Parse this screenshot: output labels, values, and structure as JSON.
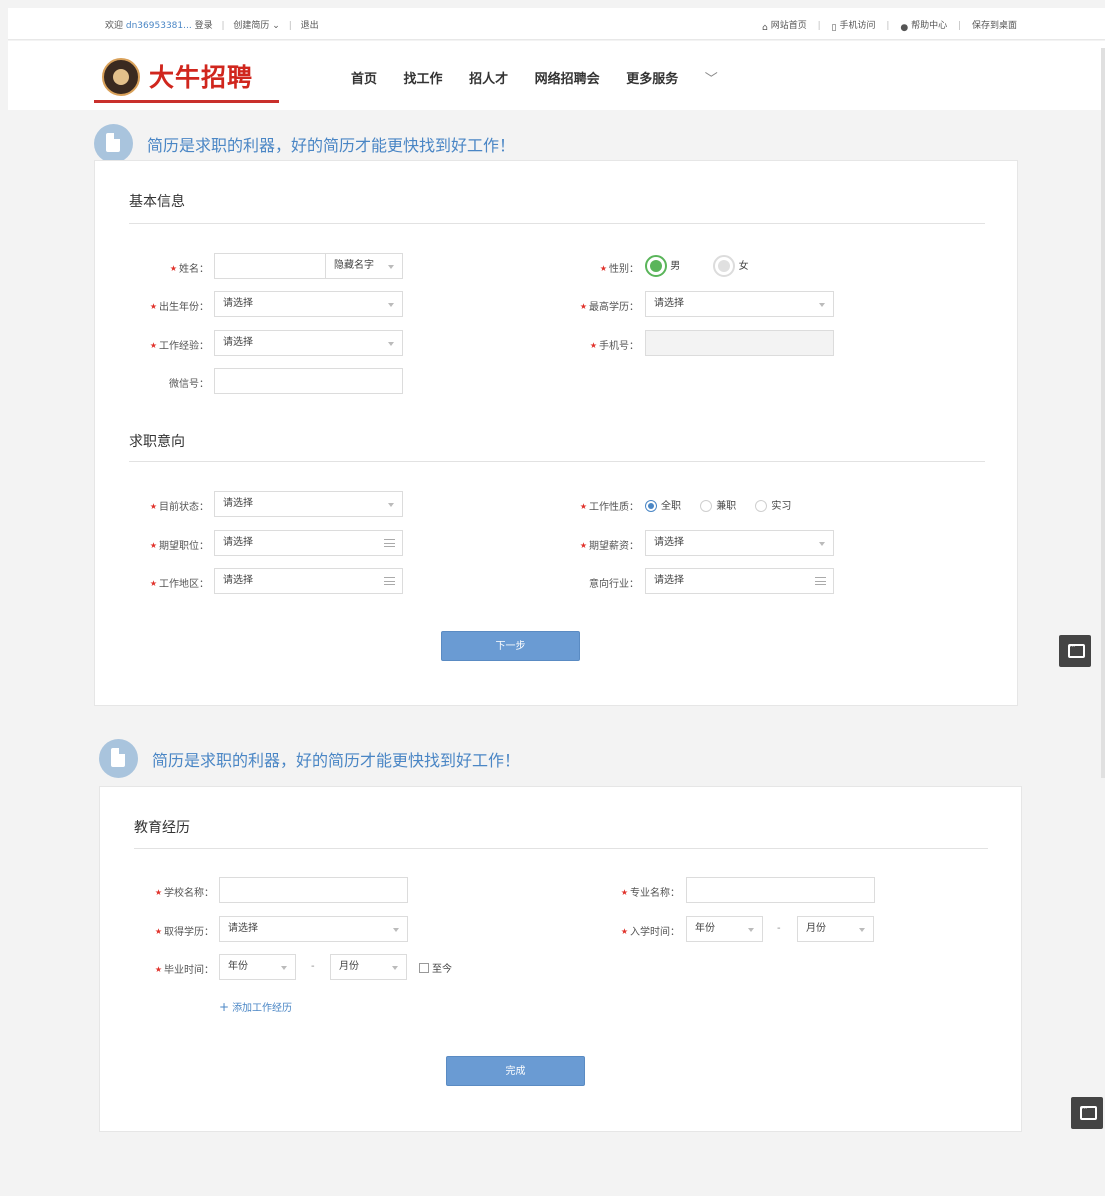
{
  "topbar": {
    "welcome": "欢迎",
    "username": "dn36953381...",
    "login": "登录",
    "create_resume": "创建简历",
    "logout": "退出",
    "site_home": "网站首页",
    "mobile": "手机访问",
    "help": "帮助中心",
    "save_desktop": "保存到桌面"
  },
  "header": {
    "logo_text": "大牛招聘",
    "nav": [
      "首页",
      "找工作",
      "招人才",
      "网络招聘会",
      "更多服务"
    ]
  },
  "section1": {
    "tagline": "简历是求职的利器，好的简历才能更快找到好工作！",
    "basic_title": "基本信息",
    "name_label": "姓名：",
    "name_value": "",
    "hide_name": "隐藏名字",
    "gender_label": "性别：",
    "gender_male": "男",
    "gender_female": "女",
    "birth_label": "出生年份：",
    "birth_value": "请选择",
    "edu_label": "最高学历：",
    "edu_value": "请选择",
    "exp_label": "工作经验：",
    "exp_value": "请选择",
    "phone_label": "手机号：",
    "phone_value": "",
    "wechat_label": "微信号：",
    "wechat_value": "",
    "intent_title": "求职意向",
    "status_label": "目前状态：",
    "status_value": "请选择",
    "nature_label": "工作性质：",
    "nature_options": [
      "全职",
      "兼职",
      "实习"
    ],
    "position_label": "期望职位：",
    "position_value": "请选择",
    "salary_label": "期望薪资：",
    "salary_value": "请选择",
    "area_label": "工作地区：",
    "area_value": "请选择",
    "industry_label": "意向行业：",
    "industry_value": "请选择",
    "next_button": "下一步"
  },
  "section2": {
    "tagline": "简历是求职的利器，好的简历才能更快找到好工作！",
    "edu_title": "教育经历",
    "school_label": "学校名称：",
    "school_value": "",
    "major_label": "专业名称：",
    "major_value": "",
    "degree_label": "取得学历：",
    "degree_value": "请选择",
    "enroll_label": "入学时间：",
    "enroll_year": "年份",
    "enroll_month": "月份",
    "grad_label": "毕业时间：",
    "grad_year": "年份",
    "grad_month": "月份",
    "dash": "-",
    "until_now": "至今",
    "add_work": "添加工作经历",
    "add_plus": "+",
    "finish_button": "完成"
  },
  "colors": {
    "accent": "#4a86c5",
    "button": "#6a9bd3",
    "required": "#e0312a",
    "logo_red": "#d0261d"
  }
}
